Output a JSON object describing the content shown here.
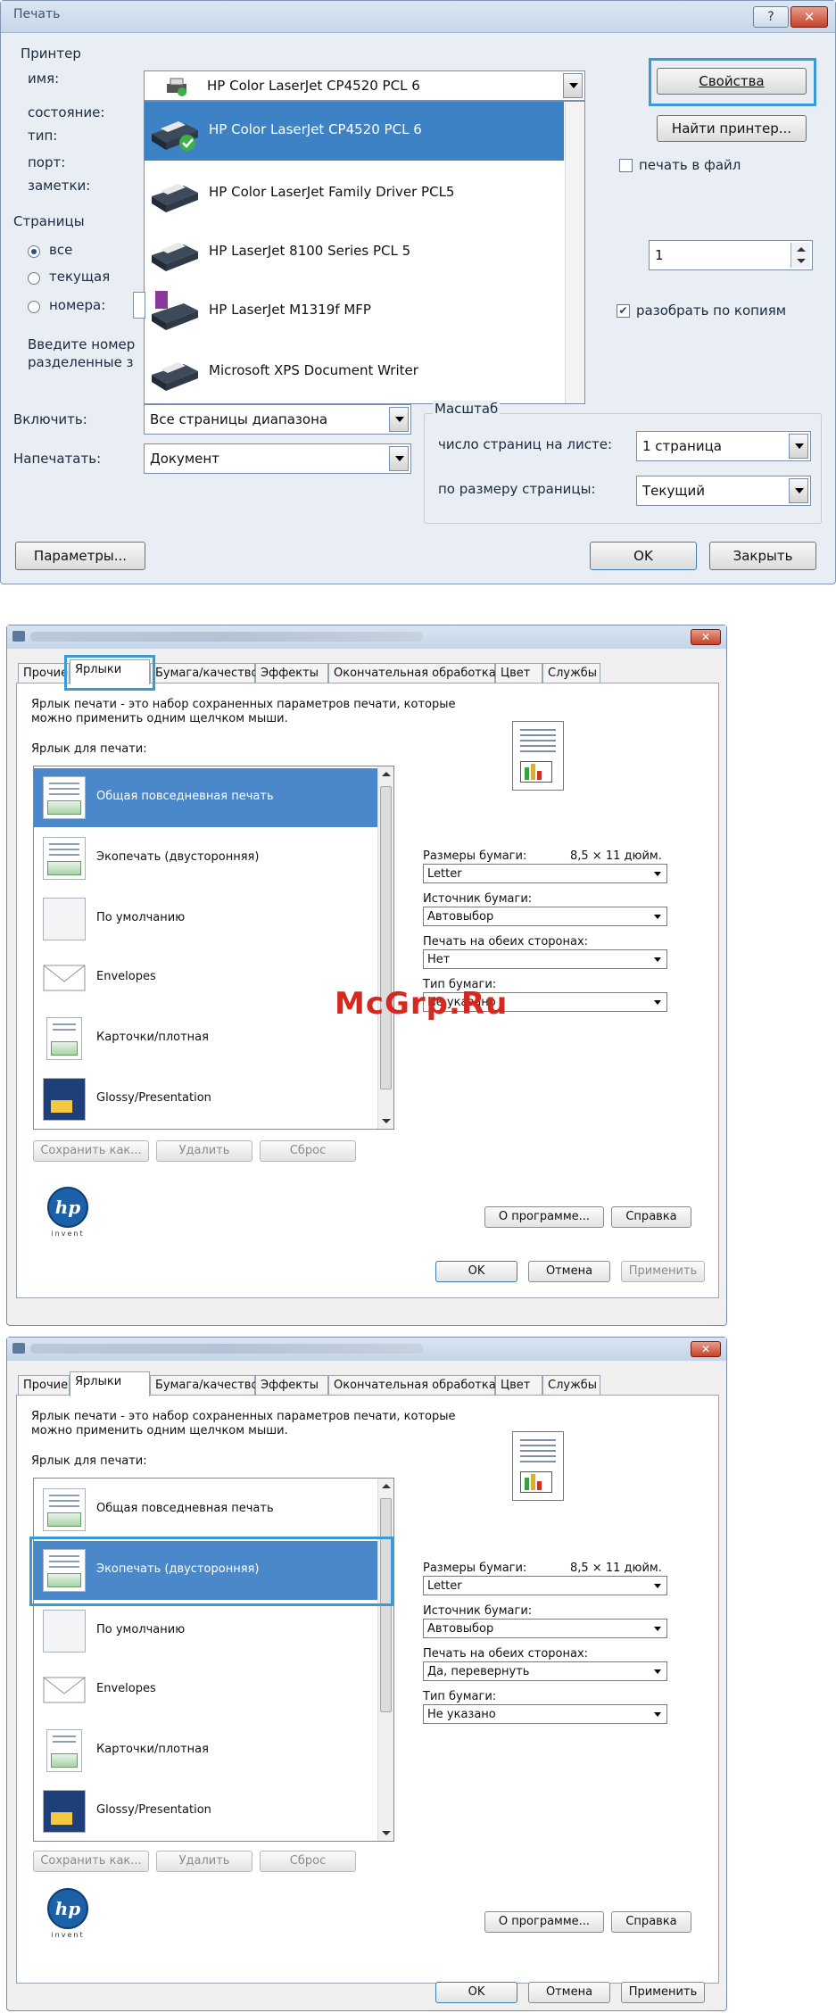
{
  "dialog1": {
    "title": "Печать",
    "help_btn": "?",
    "printer_group": "Принтер",
    "name_label": "имя:",
    "status_label": "состояние:",
    "type_label": "тип:",
    "port_label": "порт:",
    "notes_label": "заметки:",
    "selected_printer": "HP Color LaserJet CP4520 PCL 6",
    "printers": [
      "HP Color LaserJet CP4520 PCL 6",
      "HP Color LaserJet Family Driver PCL5",
      "HP LaserJet 8100 Series PCL 5",
      "HP LaserJet M1319f MFP",
      "Microsoft XPS Document Writer"
    ],
    "properties_btn": "Свойства",
    "find_printer_btn": "Найти принтер...",
    "print_to_file": "печать в файл",
    "pages_group": "Страницы",
    "radio_all": "все",
    "radio_current": "текущая",
    "radio_pages": "номера:",
    "hint_line1": "Введите номер",
    "hint_line2": "разделенные з",
    "copies_value": "1",
    "collate": "разобрать по копиям",
    "include_label": "Включить:",
    "include_value": "Все страницы диапазона",
    "print_label": "Напечатать:",
    "print_value": "Документ",
    "scale_group": "Масштаб",
    "pages_per_sheet_label": "число страниц на листе:",
    "pages_per_sheet_value": "1 страница",
    "fit_label": "по размеру страницы:",
    "fit_value": "Текущий",
    "params_btn": "Параметры...",
    "ok_btn": "OK",
    "close_btn": "Закрыть"
  },
  "dialog2": {
    "tabs": [
      "Прочие",
      "Ярлыки",
      "Бумага/качество",
      "Эффекты",
      "Окончательная обработка",
      "Цвет",
      "Службы"
    ],
    "description_line1": "Ярлык печати - это набор сохраненных параметров печати, которые",
    "description_line2": "можно применить одним щелчком мыши.",
    "shortcuts_label": "Ярлык для печати:",
    "shortcuts": [
      "Общая повседневная печать",
      "Экопечать (двусторонняя)",
      "По умолчанию",
      "Envelopes",
      "Карточки/плотная",
      "Glossy/Presentation"
    ],
    "paper_size_label": "Размеры бумаги:",
    "paper_size_dims": "8,5 × 11 дюйм.",
    "paper_size_value": "Letter",
    "paper_source_label": "Источник бумаги:",
    "paper_source_value": "Автовыбор",
    "duplex_label": "Печать на обеих сторонах:",
    "duplex_value": "Нет",
    "paper_type_label": "Тип бумаги:",
    "paper_type_value": "Не указано",
    "save_as_btn": "Сохранить как...",
    "delete_btn": "Удалить",
    "reset_btn": "Сброс",
    "hp_text": "hp",
    "hp_invent": "invent",
    "about_btn": "О программе...",
    "help_btn": "Справка",
    "ok_btn": "OK",
    "cancel_btn": "Отмена",
    "apply_btn": "Применить"
  },
  "dialog3": {
    "duplex_value": "Да, перевернуть",
    "paper_type_label": "Тип бумаги:"
  },
  "watermark": "McGrp.Ru",
  "colors": {
    "selection": "#4b88c9",
    "highlight": "#3a9ad8",
    "close": "#c4432a"
  }
}
